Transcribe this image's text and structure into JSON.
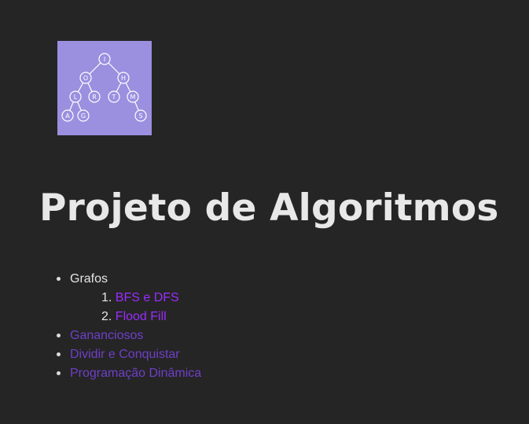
{
  "logo": {
    "nodes": [
      "I",
      "O",
      "H",
      "L",
      "R",
      "T",
      "M",
      "A",
      "G",
      "S"
    ]
  },
  "title": "Projeto de Algoritmos",
  "topics": [
    {
      "label": "Grafos",
      "subtopics": [
        {
          "number": "1.",
          "label": "BFS e DFS"
        },
        {
          "number": "2.",
          "label": "Flood Fill"
        }
      ]
    },
    {
      "label": "Gananciosos"
    },
    {
      "label": "Dividir e Conquistar"
    },
    {
      "label": "Programação Dinâmica"
    }
  ],
  "colors": {
    "background": "#252525",
    "logo_background": "#9b8fe0",
    "link": "#9b2cff",
    "visited_link": "#6f3fc8"
  }
}
